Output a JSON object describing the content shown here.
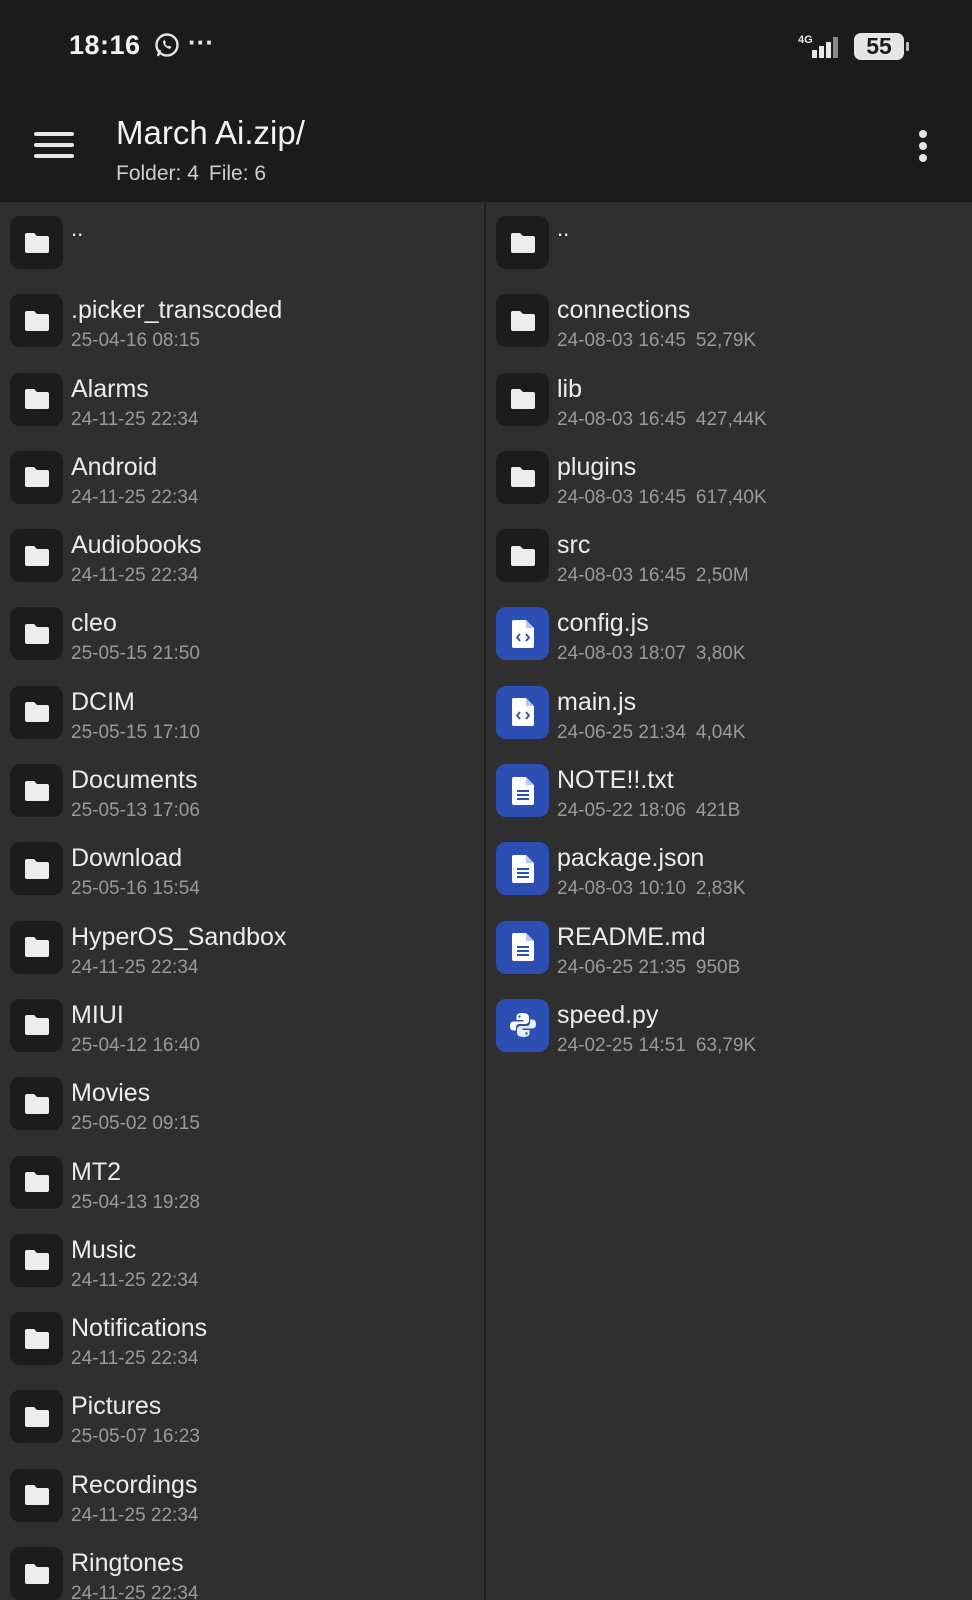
{
  "status": {
    "time": "18:16",
    "network": "4G",
    "battery": "55"
  },
  "appbar": {
    "title": "March Ai.zip/",
    "folders": "Folder: 4",
    "files": "File: 6"
  },
  "left": [
    {
      "name": "..",
      "date": "",
      "icon": "folder-icon"
    },
    {
      "name": ".picker_transcoded",
      "date": "25-04-16 08:15",
      "icon": "folder-icon"
    },
    {
      "name": "Alarms",
      "date": "24-11-25 22:34",
      "icon": "folder-icon"
    },
    {
      "name": "Android",
      "date": "24-11-25 22:34",
      "icon": "folder-icon"
    },
    {
      "name": "Audiobooks",
      "date": "24-11-25 22:34",
      "icon": "folder-icon"
    },
    {
      "name": "cleo",
      "date": "25-05-15 21:50",
      "icon": "folder-icon"
    },
    {
      "name": "DCIM",
      "date": "25-05-15 17:10",
      "icon": "folder-icon"
    },
    {
      "name": "Documents",
      "date": "25-05-13 17:06",
      "icon": "folder-icon"
    },
    {
      "name": "Download",
      "date": "25-05-16 15:54",
      "icon": "folder-icon"
    },
    {
      "name": "HyperOS_Sandbox",
      "date": "24-11-25 22:34",
      "icon": "folder-icon"
    },
    {
      "name": "MIUI",
      "date": "25-04-12 16:40",
      "icon": "folder-icon"
    },
    {
      "name": "Movies",
      "date": "25-05-02 09:15",
      "icon": "folder-icon"
    },
    {
      "name": "MT2",
      "date": "25-04-13 19:28",
      "icon": "folder-icon"
    },
    {
      "name": "Music",
      "date": "24-11-25 22:34",
      "icon": "folder-icon"
    },
    {
      "name": "Notifications",
      "date": "24-11-25 22:34",
      "icon": "folder-icon"
    },
    {
      "name": "Pictures",
      "date": "25-05-07 16:23",
      "icon": "folder-icon"
    },
    {
      "name": "Recordings",
      "date": "24-11-25 22:34",
      "icon": "folder-icon"
    },
    {
      "name": "Ringtones",
      "date": "24-11-25 22:34",
      "icon": "folder-icon"
    }
  ],
  "right": [
    {
      "name": "..",
      "date": "",
      "size": "",
      "icon": "folder-icon"
    },
    {
      "name": "connections",
      "date": "24-08-03 16:45",
      "size": "52,79K",
      "icon": "folder-icon"
    },
    {
      "name": "lib",
      "date": "24-08-03 16:45",
      "size": "427,44K",
      "icon": "folder-icon"
    },
    {
      "name": "plugins",
      "date": "24-08-03 16:45",
      "size": "617,40K",
      "icon": "folder-icon"
    },
    {
      "name": "src",
      "date": "24-08-03 16:45",
      "size": "2,50M",
      "icon": "folder-icon"
    },
    {
      "name": "config.js",
      "date": "24-08-03 18:07",
      "size": "3,80K",
      "icon": "code-file-icon"
    },
    {
      "name": "main.js",
      "date": "24-06-25 21:34",
      "size": "4,04K",
      "icon": "code-file-icon"
    },
    {
      "name": "NOTE!!.txt",
      "date": "24-05-22 18:06",
      "size": "421B",
      "icon": "text-file-icon"
    },
    {
      "name": "package.json",
      "date": "24-08-03 10:10",
      "size": "2,83K",
      "icon": "text-file-icon"
    },
    {
      "name": "README.md",
      "date": "24-06-25 21:35",
      "size": "950B",
      "icon": "text-file-icon"
    },
    {
      "name": "speed.py",
      "date": "24-02-25 14:51",
      "size": "63,79K",
      "icon": "python-file-icon"
    }
  ],
  "colors": {
    "background": "#2f2f2f",
    "appbar": "#1b1b1b",
    "folder_tile": "#1c1c1c",
    "file_tile": "#2d4fb3"
  }
}
